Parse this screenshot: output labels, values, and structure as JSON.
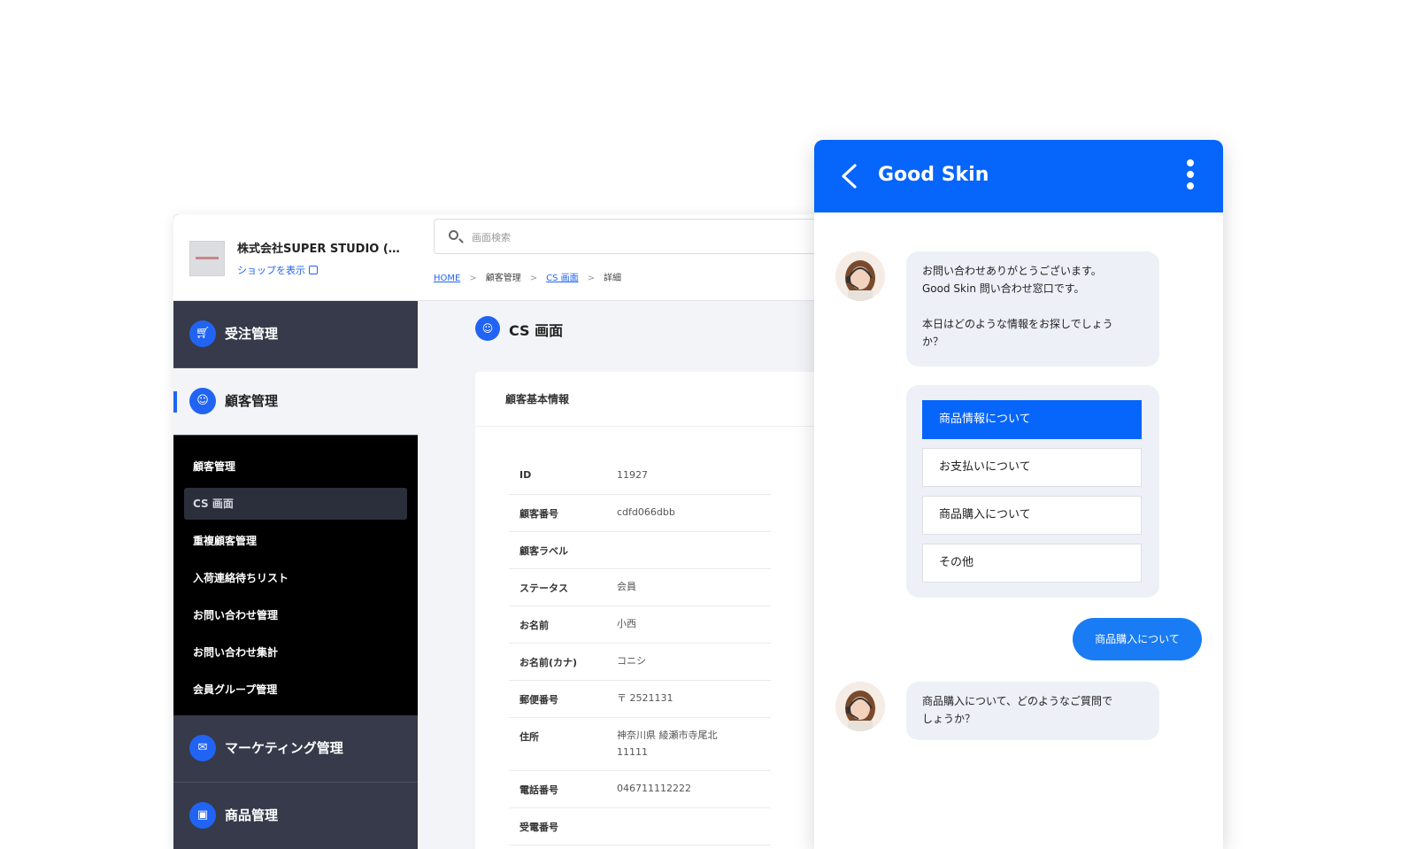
{
  "shop": {
    "name": "株式会社SUPER STUDIO (…",
    "view_link": "ショップを表示"
  },
  "nav": {
    "orders": "受注管理",
    "customers": "顧客管理",
    "marketing": "マーケティング管理",
    "products": "商品管理"
  },
  "subnav": {
    "items": [
      "顧客管理",
      "CS 画面",
      "重複顧客管理",
      "入荷連絡待ちリスト",
      "お問い合わせ管理",
      "お問い合わせ集計",
      "会員グループ管理"
    ]
  },
  "search": {
    "placeholder": "画面検索"
  },
  "breadcrumb": {
    "home": "HOME",
    "customers": "顧客管理",
    "cs": "CS 画面",
    "detail": "詳細",
    "separator": ">"
  },
  "page": {
    "title": "CS 画面"
  },
  "card": {
    "title": "顧客基本情報",
    "rows": [
      {
        "key": "ID",
        "value": "11927"
      },
      {
        "key": "顧客番号",
        "value": "cdfd066dbb"
      },
      {
        "key": "顧客ラベル",
        "value": ""
      },
      {
        "key": "ステータス",
        "value": "会員"
      },
      {
        "key": "お名前",
        "value": "小西"
      },
      {
        "key": "お名前(カナ)",
        "value": "コニシ"
      },
      {
        "key": "郵便番号",
        "value": "〒 2521131"
      },
      {
        "key": "住所",
        "value": "神奈川県 綾瀬市寺尾北",
        "value2": "11111"
      },
      {
        "key": "電話番号",
        "value": "046711112222"
      },
      {
        "key": "受電番号",
        "value": ""
      }
    ]
  },
  "chat": {
    "title": "Good Skin",
    "bot_message_1": [
      "お問い合わせありがとうございます。",
      "Good Skin 問い合わせ窓口です。",
      "",
      "本日はどのような情報をお探しでしょう",
      "か？"
    ],
    "options": [
      "商品情報について",
      "お支払いについて",
      "商品購入について",
      "その他"
    ],
    "user_message": "商品購入について",
    "bot_message_2": [
      "商品購入について、どのようなご質問で",
      "しょうか？"
    ]
  },
  "colors": {
    "accent": "#0665fb",
    "nav_bg": "#363a4a",
    "subnav_bg": "#000000",
    "bubble_bg": "#eef0f7"
  },
  "icons": {
    "orders": "cart-icon",
    "customers": "user-circle-icon",
    "marketing": "mail-icon",
    "products": "box-icon",
    "page": "user-circle-icon",
    "chat_back": "chevron-left-icon",
    "chat_menu": "more-vertical-icon"
  }
}
